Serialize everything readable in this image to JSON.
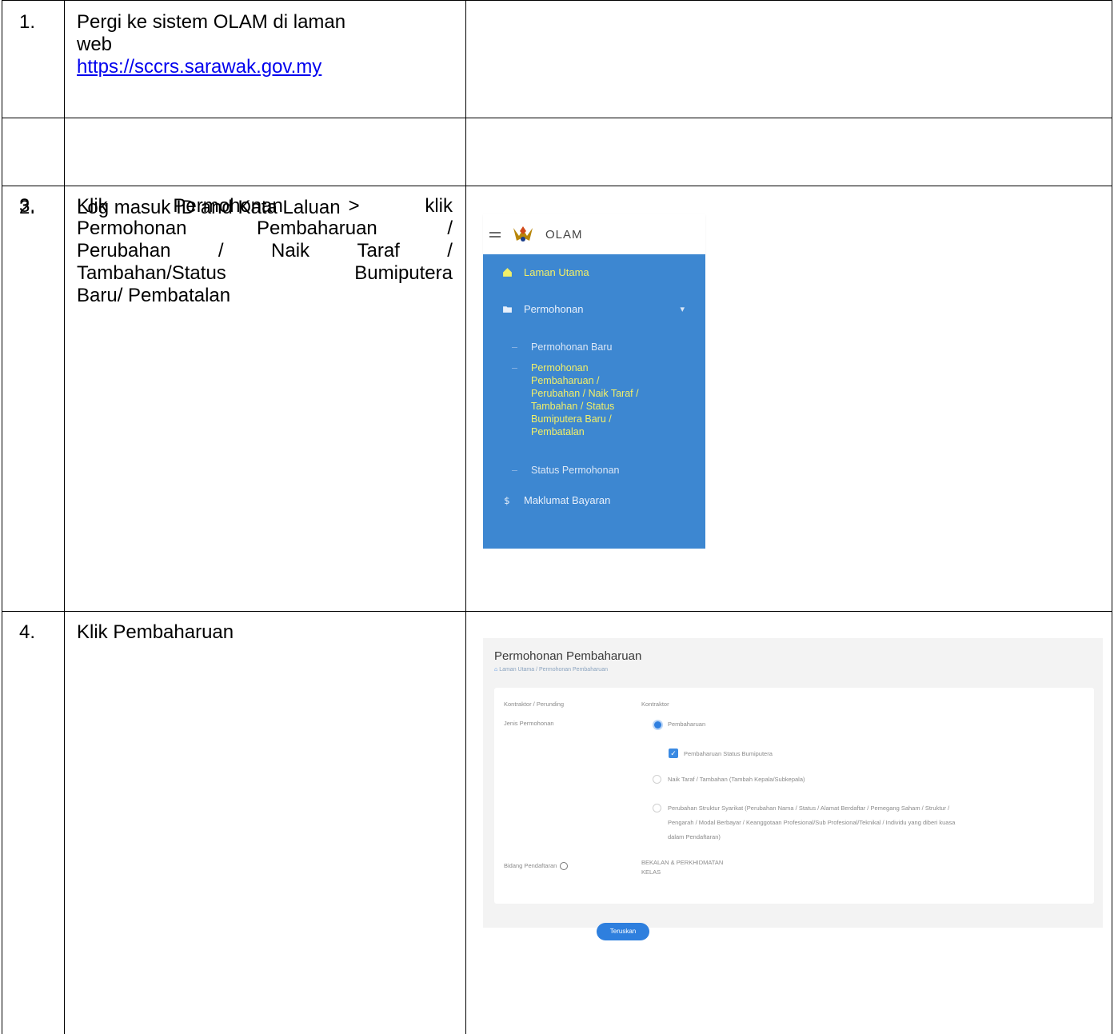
{
  "steps": [
    {
      "num": "1.",
      "line1": "Pergi ke sistem OLAM di laman",
      "line2": "web",
      "link": "https://sccrs.sarawak.gov.my"
    },
    {
      "num": "2.",
      "text": "Log masuk ID and Kata Laluan"
    },
    {
      "num": "3.",
      "lines": [
        [
          "Klik",
          "Permohonan",
          ">",
          "klik"
        ],
        [
          "Permohonan",
          "Pembaharuan",
          "/"
        ],
        [
          "Perubahan",
          "/",
          "Naik",
          "Taraf",
          "/"
        ],
        [
          "Tambahan/Status",
          "Bumiputera"
        ],
        [
          "Baru/ Pembatalan"
        ]
      ]
    },
    {
      "num": "4.",
      "text": "Klik Pembaharuan"
    }
  ],
  "olam": {
    "title": "OLAM",
    "menu": {
      "laman_utama": "Laman Utama",
      "permohonan": "Permohonan",
      "permohonan_baru": "Permohonan Baru",
      "pembaharuan_lines": [
        "Permohonan",
        "Pembaharuan /",
        "Perubahan / Naik Taraf /",
        "Tambahan / Status",
        "Bumiputera Baru /",
        "Pembatalan"
      ],
      "status_permohonan": "Status Permohonan",
      "maklumat_bayaran": "Maklumat Bayaran"
    },
    "colors": {
      "menu_bg": "#3d87d1",
      "active": "#f2ef68"
    }
  },
  "form": {
    "title": "Permohonan Pembaharuan",
    "breadcrumb": "Laman Utama / Permohonan Pembaharuan",
    "label_kontraktor": "Kontraktor / Perunding",
    "value_kontraktor": "Kontraktor",
    "label_jenis": "Jenis Permohonan",
    "opt_pembaharuan": "Pembaharuan",
    "opt_status_bumiputera": "Pembaharuan Status Bumiputera",
    "opt_naik_taraf": "Naik Taraf / Tambahan (Tambah Kepala/Subkepala)",
    "opt_perubahan_lines": [
      "Perubahan Struktur Syarikat (Perubahan Nama / Status / Alamat Berdaftar / Pemegang Saham / Struktur /",
      "Pengarah / Modal Berbayar / Keanggotaan Profesional/Sub Profesional/Teknikal / Individu yang diberi kuasa",
      "dalam Pendaftaran)"
    ],
    "label_bidang": "Bidang Pendaftaran",
    "value_bidang_lines": [
      "BEKALAN & PERKHIDMATAN",
      "KELAS"
    ],
    "submit": "Teruskan"
  }
}
